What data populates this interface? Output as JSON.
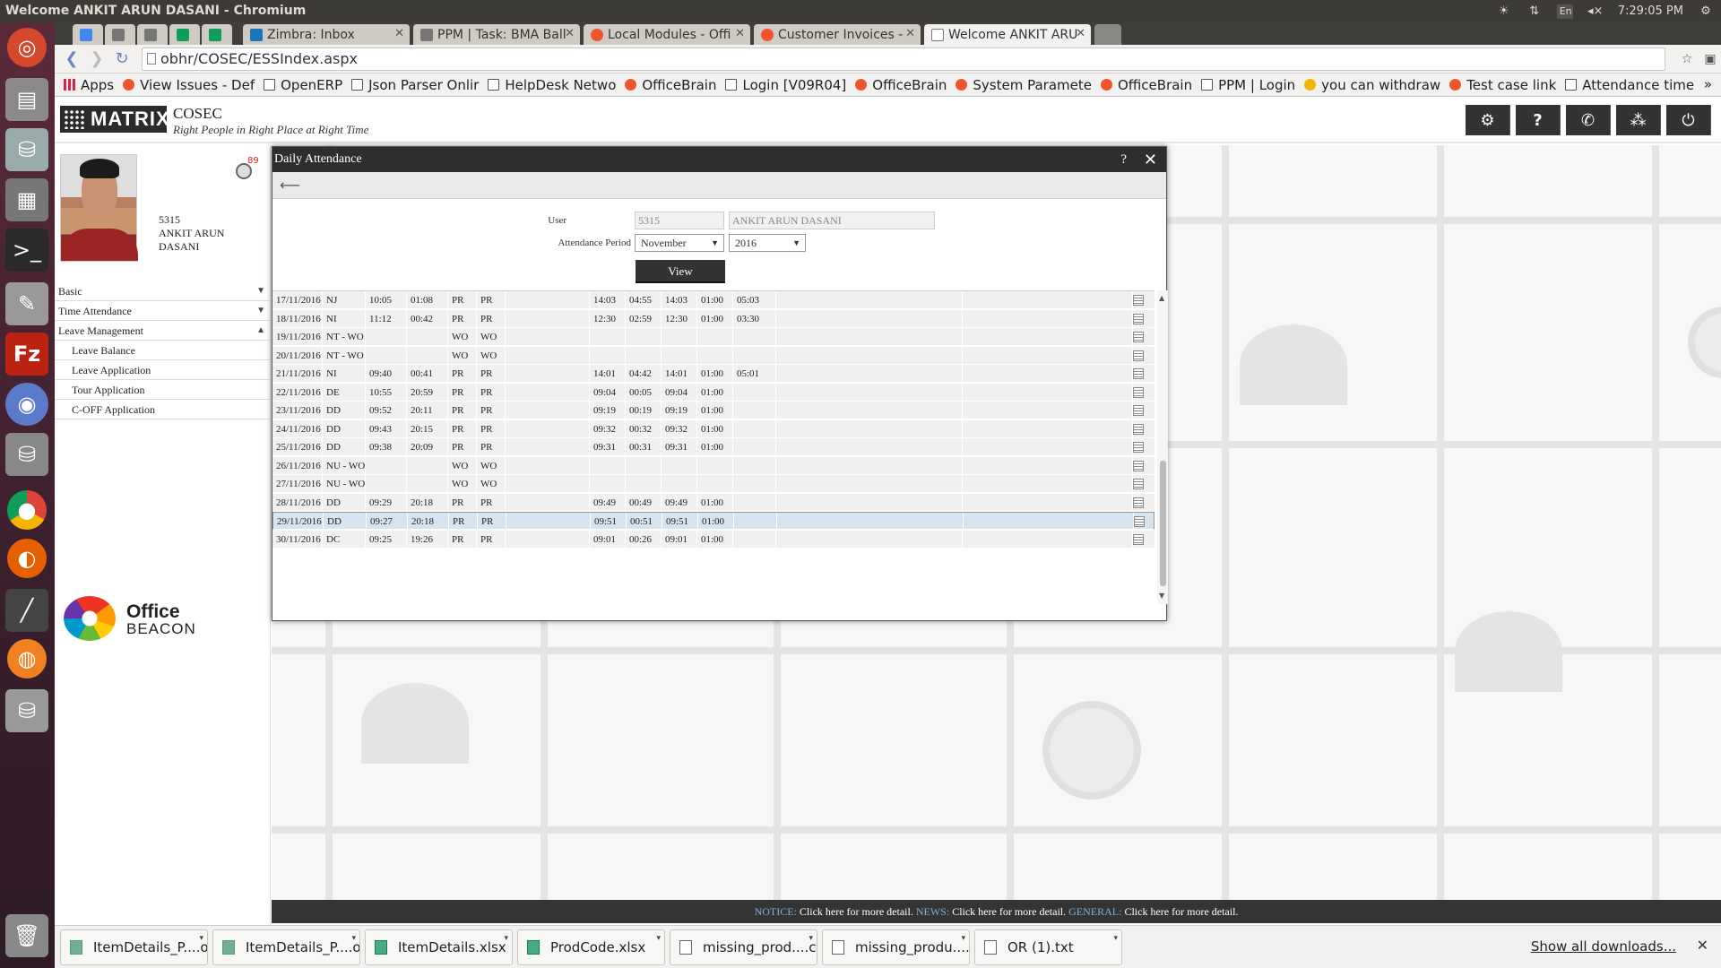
{
  "window": {
    "title": "Welcome ANKIT ARUN DASANI - Chromium",
    "time": "7:29:05 PM",
    "lang": "En"
  },
  "tabs": [
    {
      "label": "",
      "icon": "drive-icon",
      "color": "#4285f4"
    },
    {
      "label": "",
      "icon": "pm-icon",
      "color": "#777777"
    },
    {
      "label": "",
      "icon": "pm-icon",
      "color": "#777777"
    },
    {
      "label": "",
      "icon": "sheets-icon",
      "color": "#0f9d58"
    },
    {
      "label": "",
      "icon": "sheets-icon",
      "color": "#0f9d58"
    },
    {
      "label": "Zimbra: Inbox",
      "icon": "zimbra-icon",
      "color": "#1a75bb"
    },
    {
      "label": "PPM | Task: BMA Ball",
      "icon": "pm-icon",
      "color": "#777777"
    },
    {
      "label": "Local Modules - Offi",
      "icon": "officebrain-icon",
      "color": "#f0542d"
    },
    {
      "label": "Customer Invoices - ",
      "icon": "officebrain-icon",
      "color": "#f0542d"
    },
    {
      "label": "Welcome ANKIT ARU",
      "icon": "page-icon",
      "color": "#ffffff"
    }
  ],
  "address": "obhr/COSEC/ESSIndex.aspx",
  "bookmarks": [
    {
      "label": "Apps",
      "icon": "apps-grid"
    },
    {
      "label": "View Issues - Def",
      "icon": "officebrain"
    },
    {
      "label": "OpenERP",
      "icon": "page"
    },
    {
      "label": "Json Parser Onlir",
      "icon": "code"
    },
    {
      "label": "HelpDesk Netwo",
      "icon": "page"
    },
    {
      "label": "OfficeBrain",
      "icon": "officebrain"
    },
    {
      "label": "Login [V09R04]",
      "icon": "page"
    },
    {
      "label": "OfficeBrain",
      "icon": "officebrain"
    },
    {
      "label": "System Paramete",
      "icon": "officebrain"
    },
    {
      "label": "OfficeBrain",
      "icon": "officebrain"
    },
    {
      "label": "PPM | Login",
      "icon": "page"
    },
    {
      "label": "you can withdraw",
      "icon": "circle"
    },
    {
      "label": "Test case link",
      "icon": "officebrain"
    },
    {
      "label": "Attendance time",
      "icon": "page"
    }
  ],
  "app": {
    "logo": "MATRIX",
    "product": "COSEC",
    "tagline": "Right People in Right Place at Right Time"
  },
  "user": {
    "id": "5315",
    "name": "ANKIT ARUN DASANI",
    "notif_count": "89"
  },
  "menu": [
    {
      "label": "Basic",
      "arrow": "▼",
      "sub": false
    },
    {
      "label": "Time Attendance",
      "arrow": "▼",
      "sub": false
    },
    {
      "label": "Leave Management",
      "arrow": "▲",
      "sub": false
    },
    {
      "label": "Leave Balance",
      "arrow": "",
      "sub": true
    },
    {
      "label": "Leave Application",
      "arrow": "",
      "sub": true
    },
    {
      "label": "Tour Application",
      "arrow": "",
      "sub": true
    },
    {
      "label": "C-OFF Application",
      "arrow": "",
      "sub": true
    }
  ],
  "brand": {
    "line1": "Office",
    "line2": "BEACON"
  },
  "dialog": {
    "title": "Daily Attendance",
    "user_label": "User",
    "user_id": "5315",
    "user_name": "ANKIT ARUN DASANI",
    "period_label": "Attendance Period",
    "month": "November",
    "year": "2016",
    "view_label": "View"
  },
  "attendance": [
    [
      "17/11/2016",
      "NJ",
      "10:05",
      "01:08",
      "PR",
      "PR",
      "",
      "14:03",
      "04:55",
      "14:03",
      "01:00",
      "05:03"
    ],
    [
      "18/11/2016",
      "NI",
      "11:12",
      "00:42",
      "PR",
      "PR",
      "",
      "12:30",
      "02:59",
      "12:30",
      "01:00",
      "03:30"
    ],
    [
      "19/11/2016",
      "NT - WO",
      "",
      "",
      "WO",
      "WO",
      "",
      "",
      "",
      "",
      "",
      ""
    ],
    [
      "20/11/2016",
      "NT - WO",
      "",
      "",
      "WO",
      "WO",
      "",
      "",
      "",
      "",
      "",
      ""
    ],
    [
      "21/11/2016",
      "NI",
      "09:40",
      "00:41",
      "PR",
      "PR",
      "",
      "14:01",
      "04:42",
      "14:01",
      "01:00",
      "05:01"
    ],
    [
      "22/11/2016",
      "DE",
      "10:55",
      "20:59",
      "PR",
      "PR",
      "",
      "09:04",
      "00:05",
      "09:04",
      "01:00",
      ""
    ],
    [
      "23/11/2016",
      "DD",
      "09:52",
      "20:11",
      "PR",
      "PR",
      "",
      "09:19",
      "00:19",
      "09:19",
      "01:00",
      ""
    ],
    [
      "24/11/2016",
      "DD",
      "09:43",
      "20:15",
      "PR",
      "PR",
      "",
      "09:32",
      "00:32",
      "09:32",
      "01:00",
      ""
    ],
    [
      "25/11/2016",
      "DD",
      "09:38",
      "20:09",
      "PR",
      "PR",
      "",
      "09:31",
      "00:31",
      "09:31",
      "01:00",
      ""
    ],
    [
      "26/11/2016",
      "NU - WO",
      "",
      "",
      "WO",
      "WO",
      "",
      "",
      "",
      "",
      "",
      ""
    ],
    [
      "27/11/2016",
      "NU - WO",
      "",
      "",
      "WO",
      "WO",
      "",
      "",
      "",
      "",
      "",
      ""
    ],
    [
      "28/11/2016",
      "DD",
      "09:29",
      "20:18",
      "PR",
      "PR",
      "",
      "09:49",
      "00:49",
      "09:49",
      "01:00",
      ""
    ],
    [
      "29/11/2016",
      "DD",
      "09:27",
      "20:18",
      "PR",
      "PR",
      "",
      "09:51",
      "00:51",
      "09:51",
      "01:00",
      ""
    ],
    [
      "30/11/2016",
      "DC",
      "09:25",
      "19:26",
      "PR",
      "PR",
      "",
      "09:01",
      "00:26",
      "09:01",
      "01:00",
      ""
    ]
  ],
  "selected_row": 12,
  "notice": {
    "notice_key": "NOTICE:",
    "notice_text": " Click here for more detail. ",
    "news_key": "NEWS:",
    "news_text": " Click here for more detail. ",
    "general_key": "GENERAL:",
    "general_text": " Click here for more detail."
  },
  "downloads": [
    {
      "name": "ItemDetails_P....ods",
      "type": "sheet"
    },
    {
      "name": "ItemDetails_P....ods",
      "type": "sheet"
    },
    {
      "name": "ItemDetails.xlsx",
      "type": "xls"
    },
    {
      "name": "ProdCode.xlsx",
      "type": "xls"
    },
    {
      "name": "missing_prod....csv",
      "type": "doc"
    },
    {
      "name": "missing_produ....csv",
      "type": "doc"
    },
    {
      "name": "OR (1).txt",
      "type": "doc"
    }
  ],
  "show_all_downloads": "Show all downloads..."
}
